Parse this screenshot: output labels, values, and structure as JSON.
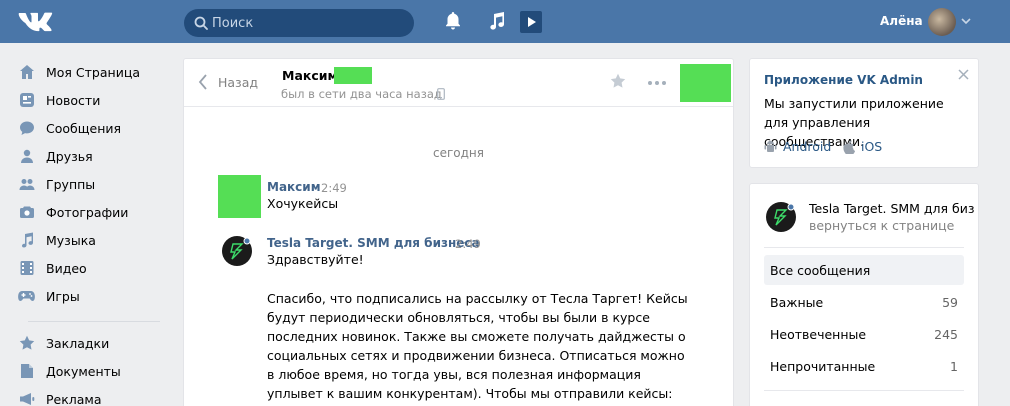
{
  "topbar": {
    "search_placeholder": "Поиск",
    "user_name": "Алёна"
  },
  "nav": {
    "items": [
      {
        "label": "Моя Страница",
        "icon": "home-icon"
      },
      {
        "label": "Новости",
        "icon": "news-icon"
      },
      {
        "label": "Сообщения",
        "icon": "messages-icon"
      },
      {
        "label": "Друзья",
        "icon": "friends-icon"
      },
      {
        "label": "Группы",
        "icon": "groups-icon"
      },
      {
        "label": "Фотографии",
        "icon": "camera-icon"
      },
      {
        "label": "Музыка",
        "icon": "music-icon"
      },
      {
        "label": "Видео",
        "icon": "video-icon"
      },
      {
        "label": "Игры",
        "icon": "gamepad-icon"
      }
    ],
    "items2": [
      {
        "label": "Закладки",
        "icon": "star-icon"
      },
      {
        "label": "Документы",
        "icon": "document-icon"
      },
      {
        "label": "Реклама",
        "icon": "megaphone-icon"
      }
    ]
  },
  "chat": {
    "back_label": "Назад",
    "title": "Максим",
    "status": "был в сети два часа назад",
    "date_separator": "сегодня",
    "messages": [
      {
        "author": "Максим",
        "time": "2:49",
        "text": [
          "Хочукейсы"
        ]
      },
      {
        "author": "Tesla Target. SMM для бизнеса",
        "time": "2:49",
        "text": [
          "Здравствуйте!",
          "",
          "Спасибо, что подписались на рассылку от Тесла Таргет! Кейсы",
          "будут периодически обновляться, чтобы вы были в курсе",
          "последних новинок. Также вы сможете получать дайджесты о",
          "социальных сетях и продвижении бизнеса. Отписаться можно",
          "в любое время, но тогда увы, вся полезная информация",
          "уплывет к вашим конкурентам). Чтобы мы отправили кейсы:"
        ]
      }
    ]
  },
  "promo": {
    "title": "Приложение VK Admin",
    "desc": "Мы запустили приложение для управления сообществами.",
    "android": "Android",
    "ios": "iOS"
  },
  "community": {
    "name": "Tesla Target. SMM для биз",
    "back_link": "вернуться к странице",
    "folders": [
      {
        "label": "Все сообщения",
        "count": ""
      },
      {
        "label": "Важные",
        "count": "59"
      },
      {
        "label": "Неотвеченные",
        "count": "245"
      },
      {
        "label": "Непрочитанные",
        "count": "1"
      }
    ]
  },
  "colors": {
    "header": "#4a76a8",
    "link": "#2a5885",
    "redacted": "#55de55"
  }
}
